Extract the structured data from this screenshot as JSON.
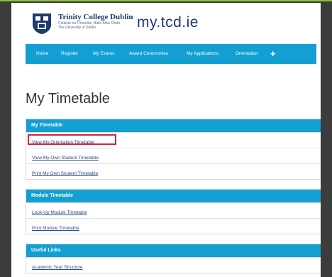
{
  "header": {
    "logo": {
      "name": "Trinity College Dublin",
      "subtitle_line1": "Coláiste na Tríonóide, Baile Átha Cliath",
      "subtitle_line2": "The University of Dublin"
    },
    "site_name": "my.tcd.ie"
  },
  "nav": {
    "items": [
      "Home",
      "Register",
      "My Exams",
      "Award Ceremonies",
      "My Applications",
      "Orientation"
    ],
    "plus": "+"
  },
  "page_title": "My Timetable",
  "panels": [
    {
      "title": "My Timetable",
      "links": [
        "View My Orientation Timetable",
        "View My Own Student Timetable",
        "Print My Own Student Timetable"
      ]
    },
    {
      "title": "Module Timetable",
      "links": [
        "Look-Up Module Timetable",
        "Print Module Timetable"
      ]
    },
    {
      "title": "Useful Links",
      "links": [
        "Academic Year Structure"
      ]
    }
  ],
  "colors": {
    "nav_bg": "#139fd2",
    "brand_navy": "#1c3b6e",
    "highlight_border": "#d0253a",
    "backdrop": "#3c3c3c"
  }
}
